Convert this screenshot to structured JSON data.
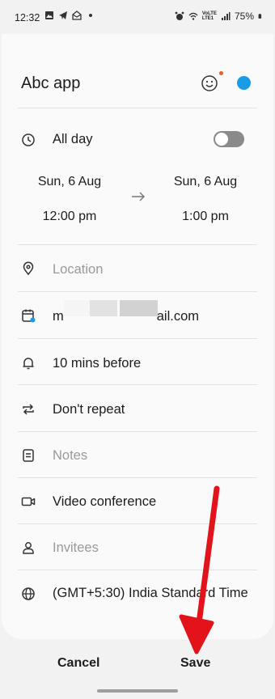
{
  "status_bar": {
    "time": "12:32",
    "battery": "75%",
    "volte_label_top": "VoLTE",
    "volte_label_bottom": "LTE1"
  },
  "header": {
    "title": "Abc app",
    "calendar_color": "#1a9be6"
  },
  "all_day": {
    "label": "All day",
    "enabled": false
  },
  "start": {
    "date": "Sun, 6 Aug",
    "time": "12:00 pm"
  },
  "end": {
    "date": "Sun, 6 Aug",
    "time": "1:00 pm"
  },
  "location": {
    "placeholder": "Location"
  },
  "account": {
    "prefix": "m",
    "suffix": "ail.com"
  },
  "reminder": {
    "label": "10 mins before"
  },
  "repeat": {
    "label": "Don't repeat"
  },
  "notes": {
    "placeholder": "Notes"
  },
  "video": {
    "label": "Video conference"
  },
  "invitees": {
    "placeholder": "Invitees"
  },
  "timezone": {
    "label": "(GMT+5:30) India Standard Time"
  },
  "actions": {
    "cancel": "Cancel",
    "save": "Save"
  },
  "colors": {
    "accent": "#1a9be6",
    "annotation_arrow": "#e3131b"
  }
}
